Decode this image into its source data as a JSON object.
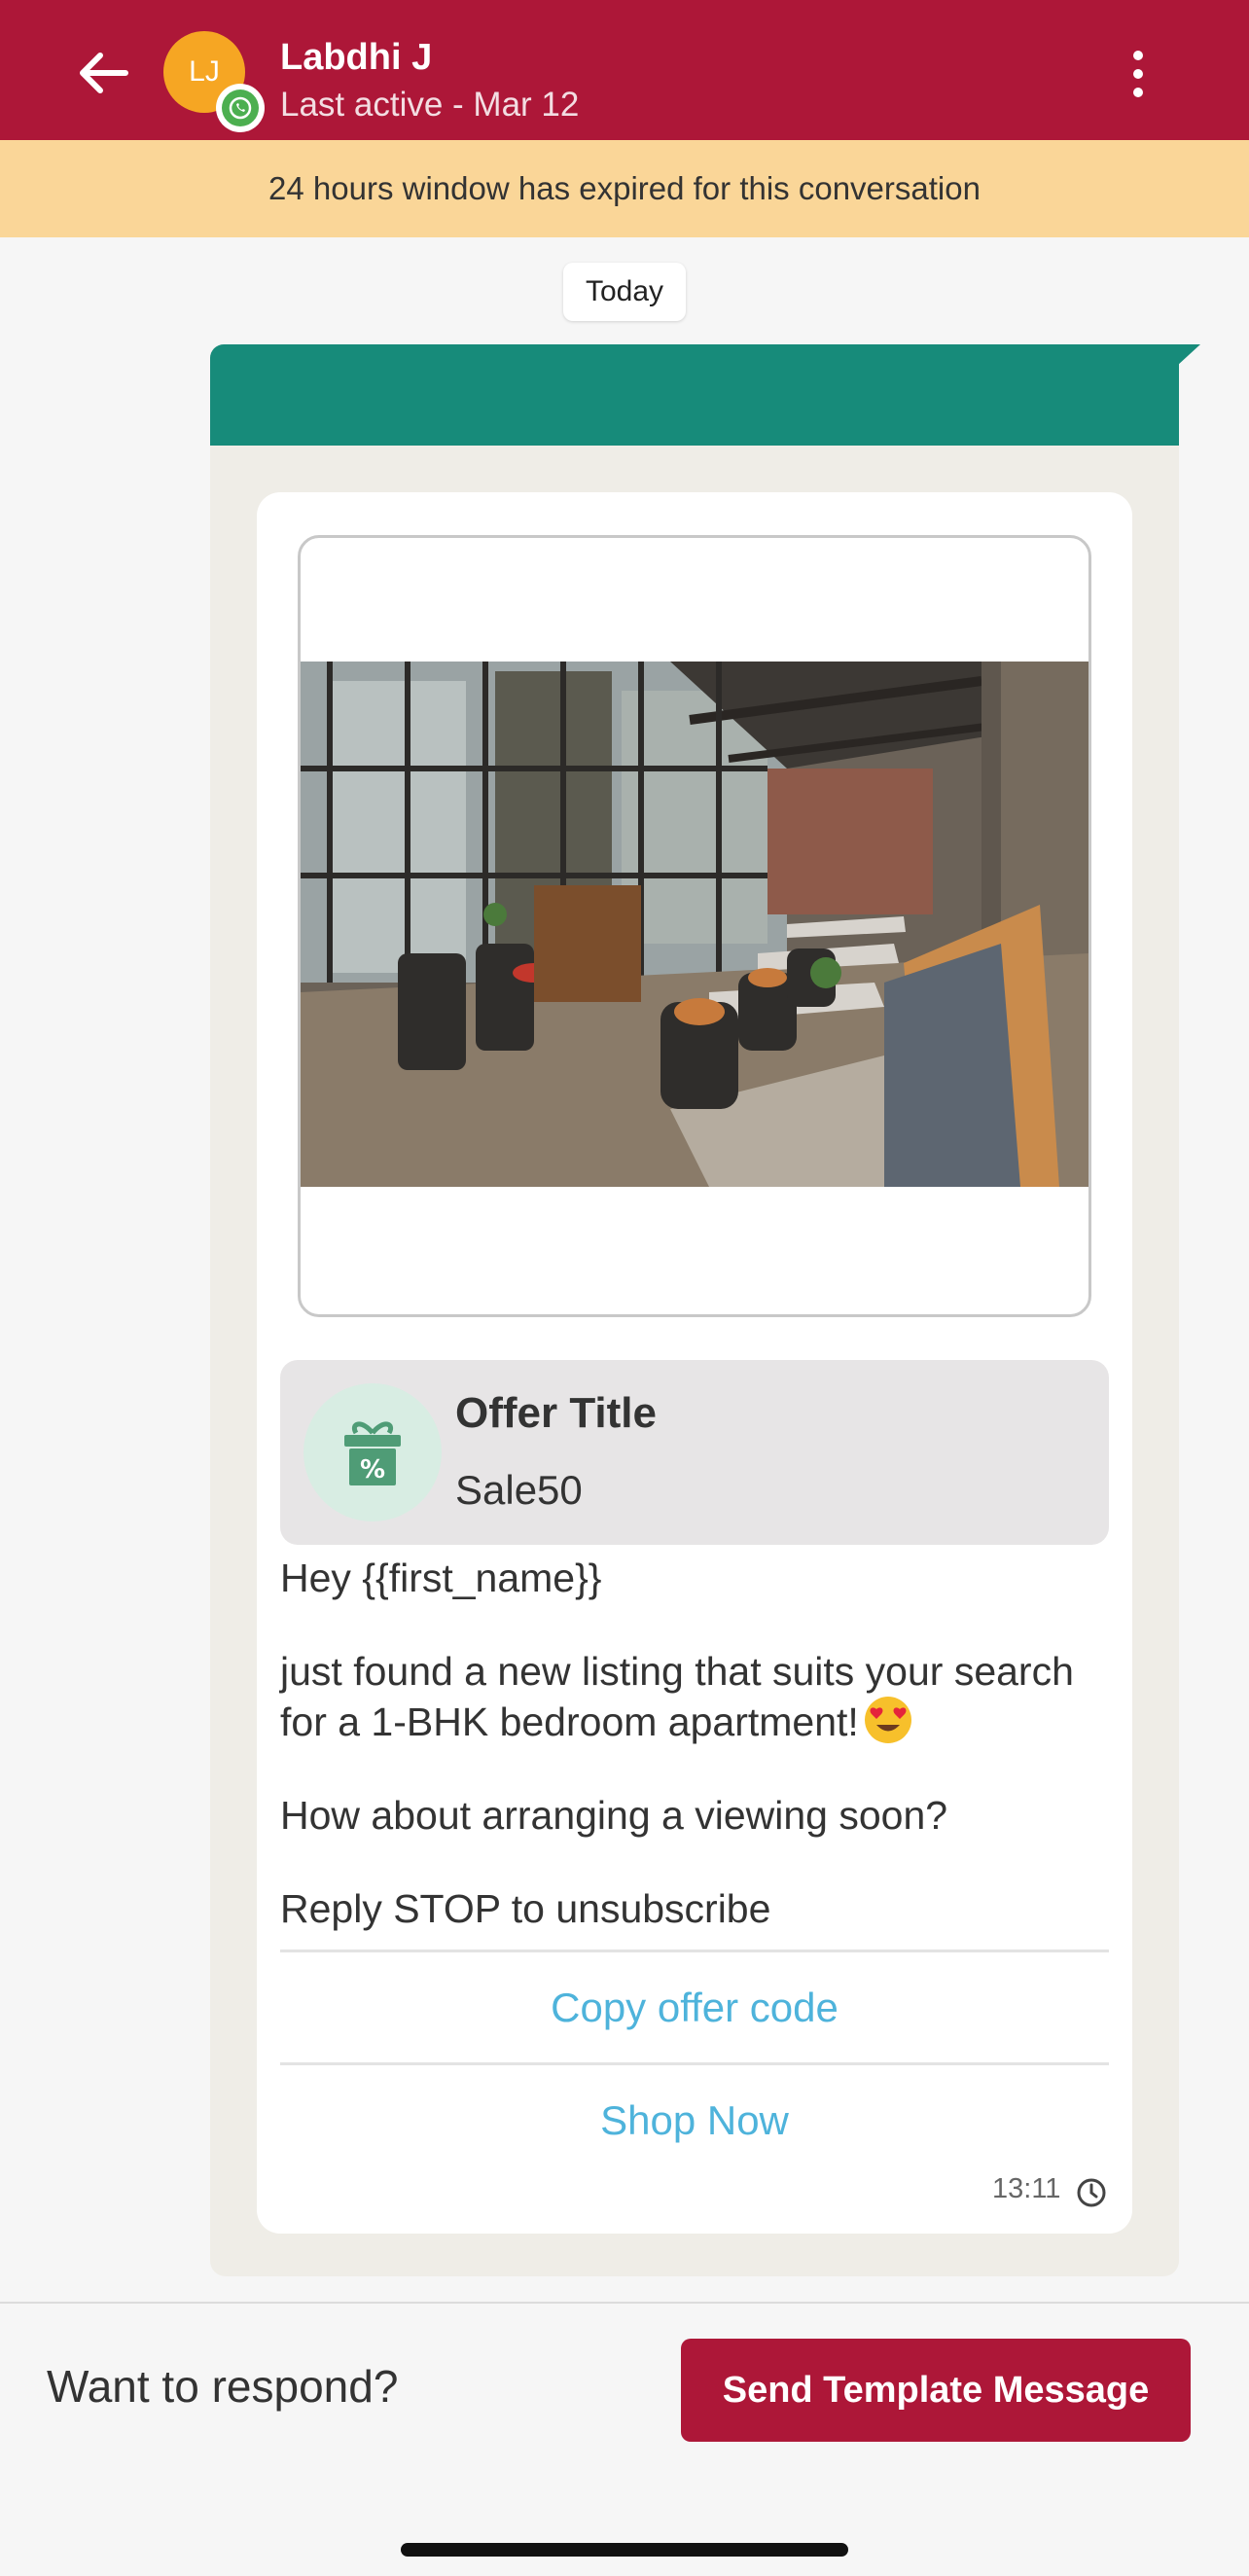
{
  "header": {
    "avatar_initials": "LJ",
    "contact_name": "Labdhi J",
    "last_active": "Last active - Mar 12",
    "back_icon": "arrow-left-icon",
    "more_icon": "more-vertical-icon",
    "channel_icon": "whatsapp-icon"
  },
  "banner": {
    "text": "24 hours window has expired for this conversation"
  },
  "chat": {
    "date_label": "Today",
    "message": {
      "offer_title": "Offer Title",
      "offer_code": "Sale50",
      "lines": [
        "Hey {{first_name}}",
        "just found a new listing that suits your search for a 1-BHK bedroom apartment!",
        "How about arranging a viewing soon?",
        "Reply STOP to unsubscribe"
      ],
      "buttons": {
        "copy_code": "Copy offer code",
        "shop_now": "Shop Now"
      },
      "time": "13:11",
      "status_icon": "clock-icon"
    }
  },
  "footer": {
    "prompt": "Want to respond?",
    "send_button": "Send Template Message"
  },
  "colors": {
    "brand": "#ad1738",
    "banner": "#fad698",
    "bubble_header": "#178b7a",
    "button_text": "#4eb3db",
    "avatar": "#f6a623"
  }
}
